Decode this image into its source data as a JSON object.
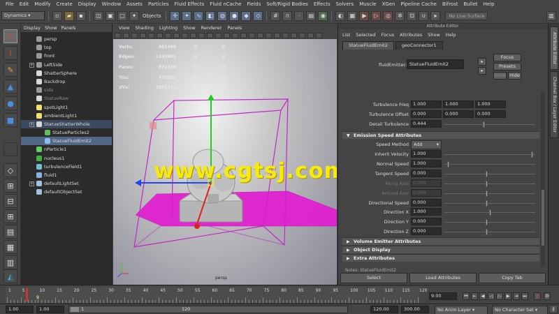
{
  "menubar": [
    "File",
    "Edit",
    "Modify",
    "Create",
    "Display",
    "Window",
    "Assets",
    "Particles",
    "Fluid Effects",
    "Fluid nCache",
    "Fields",
    "Soft/Rigid Bodies",
    "Effects",
    "Solvers",
    "Muscle",
    "XGen",
    "Pipeline Cache",
    "Bifrost",
    "Bullet",
    "Help"
  ],
  "statusline": {
    "menuset": "Dynamics",
    "objects_label": "Objects",
    "live_surface": "No Live Surface"
  },
  "outliner": {
    "menu": [
      "Display",
      "Show",
      "Panels"
    ],
    "nodes": [
      {
        "label": "persp",
        "icon": "camera-icon",
        "state": "normal",
        "expand": false,
        "indent": 0
      },
      {
        "label": "top",
        "icon": "camera-icon",
        "state": "normal",
        "expand": false,
        "indent": 0
      },
      {
        "label": "front",
        "icon": "camera-icon",
        "state": "normal",
        "expand": false,
        "indent": 0
      },
      {
        "label": "LeftSide",
        "icon": "camera-icon",
        "state": "normal",
        "expand": true,
        "indent": 0
      },
      {
        "label": "ShatterSphere",
        "icon": "transform-icon",
        "state": "normal",
        "expand": false,
        "indent": 0
      },
      {
        "label": "Backdrop",
        "icon": "transform-icon",
        "state": "normal",
        "expand": false,
        "indent": 0
      },
      {
        "label": "side",
        "icon": "camera-icon",
        "state": "dim",
        "expand": false,
        "indent": 0
      },
      {
        "label": "StatueRaw",
        "icon": "transform-icon",
        "state": "dim",
        "expand": false,
        "indent": 0
      },
      {
        "label": "spotLight1",
        "icon": "spotlight-icon",
        "state": "normal",
        "expand": false,
        "indent": 0
      },
      {
        "label": "ambientLight1",
        "icon": "ambientlight-icon",
        "state": "normal",
        "expand": false,
        "indent": 0
      },
      {
        "label": "StatueShatterWhole",
        "icon": "transform-icon",
        "state": "selected-parent",
        "expand": true,
        "indent": 0
      },
      {
        "label": "StatueParticles2",
        "icon": "particle-icon",
        "state": "normal",
        "expand": false,
        "indent": 1
      },
      {
        "label": "StatueFluidEmit2",
        "icon": "emitter-icon",
        "state": "selected",
        "expand": false,
        "indent": 1
      },
      {
        "label": "nParticle1",
        "icon": "nparticle-icon",
        "state": "normal",
        "expand": false,
        "indent": 0
      },
      {
        "label": "nucleus1",
        "icon": "nucleus-icon",
        "state": "normal",
        "expand": false,
        "indent": 0
      },
      {
        "label": "turbulenceField1",
        "icon": "field-icon",
        "state": "normal",
        "expand": false,
        "indent": 0
      },
      {
        "label": "fluid1",
        "icon": "fluid-icon",
        "state": "normal",
        "expand": false,
        "indent": 0
      },
      {
        "label": "defaultLightSet",
        "icon": "set-icon",
        "state": "normal",
        "expand": true,
        "indent": 0
      },
      {
        "label": "defaultObjectSet",
        "icon": "set-icon",
        "state": "normal",
        "expand": false,
        "indent": 0
      }
    ]
  },
  "viewport": {
    "menu": [
      "View",
      "Shading",
      "Lighting",
      "Show",
      "Renderer",
      "Panels"
    ],
    "hud": [
      {
        "k": "Verts:",
        "v1": "461968",
        "v2": "0",
        "v3": "0"
      },
      {
        "k": "Edges:",
        "v1": "1345681",
        "v2": "0",
        "v3": "0"
      },
      {
        "k": "Faces:",
        "v1": "871336",
        "v2": "0",
        "v3": "0"
      },
      {
        "k": "Tris:",
        "v1": "872353",
        "v2": "0",
        "v3": "0"
      },
      {
        "k": "UVs:",
        "v1": "2051711",
        "v2": "0",
        "v3": "0"
      }
    ],
    "camera_label": "persp",
    "watermark": "www.cgtsj.com"
  },
  "attribute_editor": {
    "title": "Attribute Editor",
    "menu": [
      "List",
      "Selected",
      "Focus",
      "Attributes",
      "Show",
      "Help"
    ],
    "tabs": [
      "StatueFluidEmit2",
      "geoConnector1"
    ],
    "field_label": "fluidEmitter:",
    "field_value": "StatueFluidEmit2",
    "focus": "Focus",
    "presets": "Presets",
    "show": "Show",
    "hide": "Hide",
    "rows": [
      {
        "label": "Turbulence Freq",
        "vals": [
          "1.000",
          "1.000",
          "1.000"
        ]
      },
      {
        "label": "Turbulence Offset",
        "vals": [
          "0.000",
          "0.000",
          "0.000"
        ]
      },
      {
        "label": "Detail Turbulence",
        "vals": [
          "0.444"
        ]
      }
    ],
    "emission_section": "Emission Speed Attributes",
    "speed_method_label": "Speed Method",
    "speed_method_value": "Add",
    "emission_rows": [
      {
        "label": "Inherit Velocity",
        "val": "1.000",
        "dis": false
      },
      {
        "label": "Normal Speed",
        "val": "1.000",
        "dis": false
      },
      {
        "label": "Tangent Speed",
        "val": "0.000",
        "dis": false
      },
      {
        "label": "Along Axis",
        "val": "0.000",
        "dis": true
      },
      {
        "label": "Around Axis",
        "val": "0.000",
        "dis": true
      },
      {
        "label": "Directional Speed",
        "val": "0.000",
        "dis": false
      },
      {
        "label": "Direction X",
        "val": "1.000",
        "dis": false
      },
      {
        "label": "Direction Y",
        "val": "0.000",
        "dis": false
      },
      {
        "label": "Direction Z",
        "val": "0.000",
        "dis": false
      }
    ],
    "collapsed_sections": [
      "Volume Emitter Attributes",
      "Object Display",
      "Extra Attributes"
    ],
    "notes": "Notes: StatueFluidEmit2",
    "buttons": [
      "Select",
      "Load Attributes",
      "Copy Tab"
    ]
  },
  "side_tabs": [
    "Attribute Editor",
    "Channel Box / Layer Editor"
  ],
  "timeline": {
    "ticks": [
      "1",
      "5",
      "10",
      "15",
      "20",
      "25",
      "30",
      "35",
      "40",
      "45",
      "50",
      "55",
      "60",
      "65",
      "70",
      "75",
      "80",
      "85",
      "90",
      "95",
      "100",
      "105",
      "110",
      "115",
      "120"
    ],
    "current_frame": "9.00",
    "current_marker": "9"
  },
  "range": {
    "start": "1.00",
    "inner_start": "1.00",
    "handle": "1",
    "end_label": "120",
    "range_end": "120.00",
    "anim_end": "300.00",
    "anim_layer": "No Anim Layer",
    "char_set": "No Character Set"
  }
}
